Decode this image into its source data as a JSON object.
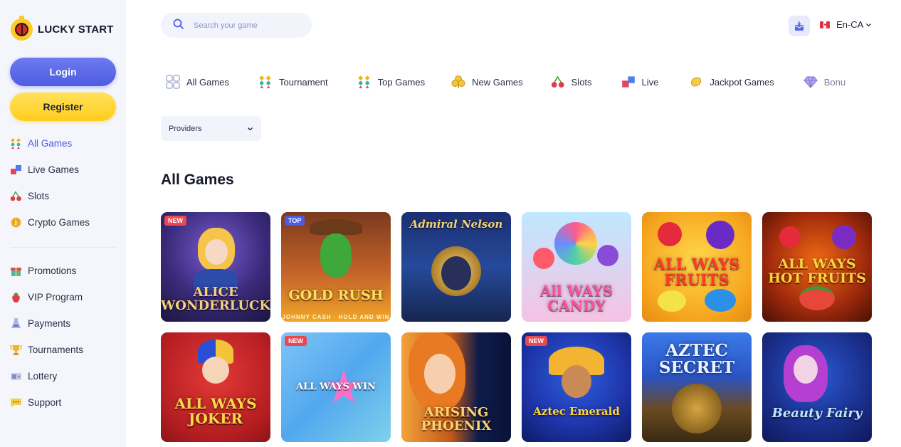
{
  "brand": {
    "name": "LUCKY START"
  },
  "auth": {
    "login_label": "Login",
    "register_label": "Register"
  },
  "sidebar": {
    "primary": [
      {
        "label": "All Games",
        "icon": "gems-icon",
        "active": true
      },
      {
        "label": "Live Games",
        "icon": "live-icon",
        "active": false
      },
      {
        "label": "Slots",
        "icon": "cherries-icon",
        "active": false
      },
      {
        "label": "Crypto Games",
        "icon": "coin-icon",
        "active": false
      }
    ],
    "secondary": [
      {
        "label": "Promotions",
        "icon": "gift-icon"
      },
      {
        "label": "VIP Program",
        "icon": "strawberry-icon"
      },
      {
        "label": "Payments",
        "icon": "payments-icon"
      },
      {
        "label": "Tournaments",
        "icon": "trophy-icon"
      },
      {
        "label": "Lottery",
        "icon": "ticket-icon"
      },
      {
        "label": "Support",
        "icon": "chat-icon"
      }
    ]
  },
  "search": {
    "placeholder": "Search your game"
  },
  "language": {
    "label": "En-CA",
    "flag": "canada-flag"
  },
  "categories": [
    {
      "label": "All Games",
      "icon": "grid-icon"
    },
    {
      "label": "Tournament",
      "icon": "gems-icon"
    },
    {
      "label": "Top Games",
      "icon": "gems-icon"
    },
    {
      "label": "New Games",
      "icon": "clover-icon"
    },
    {
      "label": "Slots",
      "icon": "cherries-icon"
    },
    {
      "label": "Live",
      "icon": "live-icon"
    },
    {
      "label": "Jackpot Games",
      "icon": "lemon-icon"
    },
    {
      "label": "Bonu",
      "icon": "diamond-icon"
    }
  ],
  "filters": {
    "providers_label": "Providers"
  },
  "main": {
    "section_title": "All Games"
  },
  "games": [
    {
      "title": "ALICE WONDERLUCK",
      "subtitle": "",
      "badge": "NEW"
    },
    {
      "title": "GOLD RUSH",
      "subtitle": "JOHNNY CASH · HOLD AND WIN",
      "badge": "TOP"
    },
    {
      "title": "Admiral Nelson",
      "subtitle": "",
      "badge": ""
    },
    {
      "title": "All WAYS CANDY",
      "subtitle": "",
      "badge": ""
    },
    {
      "title": "ALL WAYS FRUITS",
      "subtitle": "",
      "badge": ""
    },
    {
      "title": "ALL WAYS HOT FRUITS",
      "subtitle": "",
      "badge": ""
    },
    {
      "title": "ALL WAYS JOKER",
      "subtitle": "",
      "badge": ""
    },
    {
      "title": "ALL WAYS WIN",
      "subtitle": "",
      "badge": "NEW"
    },
    {
      "title": "ARISING PHOENIX",
      "subtitle": "",
      "badge": ""
    },
    {
      "title": "Aztec Emerald",
      "subtitle": "",
      "badge": "NEW"
    },
    {
      "title": "AZTEC SECRET",
      "subtitle": "",
      "badge": ""
    },
    {
      "title": "Beauty Fairy",
      "subtitle": "",
      "badge": ""
    }
  ],
  "colors": {
    "accent": "#4c5be3",
    "login": "#5a67e8",
    "register": "#ffd42b",
    "badge_new": "#e8484f",
    "badge_top": "#4c5be3"
  }
}
